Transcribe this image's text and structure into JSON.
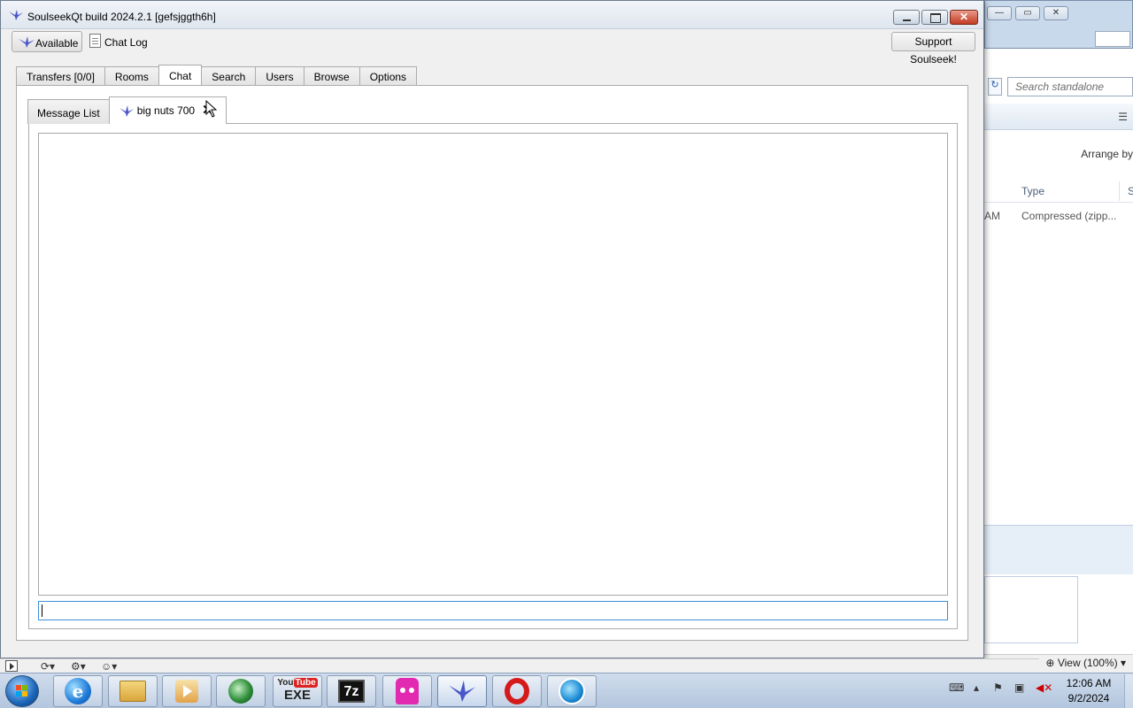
{
  "window": {
    "title": "SoulseekQt build 2024.2.1 [gefsjggth6h]",
    "close_glyph": "✕"
  },
  "toolbar": {
    "status_label": "Available",
    "chat_log_label": "Chat Log",
    "support_label": "Support Soulseek!"
  },
  "main_tabs": [
    {
      "label": "Transfers [0/0]"
    },
    {
      "label": "Rooms"
    },
    {
      "label": "Chat"
    },
    {
      "label": "Search"
    },
    {
      "label": "Users"
    },
    {
      "label": "Browse"
    },
    {
      "label": "Options"
    }
  ],
  "active_main_tab": "Chat",
  "chat": {
    "sub_tabs": [
      {
        "label": "Message List"
      },
      {
        "label": "big nuts 700",
        "close_glyph": "✕"
      }
    ],
    "input_value": ""
  },
  "explorer": {
    "search_placeholder": "Search standalone",
    "arrange_label": "Arrange by",
    "column_type": "Type",
    "column_s": "S",
    "row_time_fragment": "AM",
    "row_type": "Compressed (zipp...",
    "zoom_label": "View (100%)"
  },
  "taskbar": {
    "yt_top": "You",
    "yt_top_tube": "Tube",
    "yt_bottom": "EXE",
    "sevenzip_label": "7z",
    "ie_label": "e",
    "clock_time": "12:06 AM",
    "clock_date": "9/2/2024"
  },
  "icons": [
    "soulseek-bird-icon",
    "chat-log-icon",
    "close-icon",
    "windows-start-icon",
    "internet-explorer-icon",
    "folder-icon",
    "media-player-icon",
    "globe-icon",
    "youtube-exe-icon",
    "7zip-icon",
    "pink-app-icon",
    "soulseek-taskbar-icon",
    "opera-icon",
    "circle-app-icon",
    "flag-icon",
    "network-icon",
    "volume-muted-icon",
    "zoom-icon",
    "cursor-icon"
  ],
  "colors": {
    "accent_focus": "#3c8fd6",
    "close_button": "#c23a22",
    "soulseek_bird": "#4a56c9"
  }
}
